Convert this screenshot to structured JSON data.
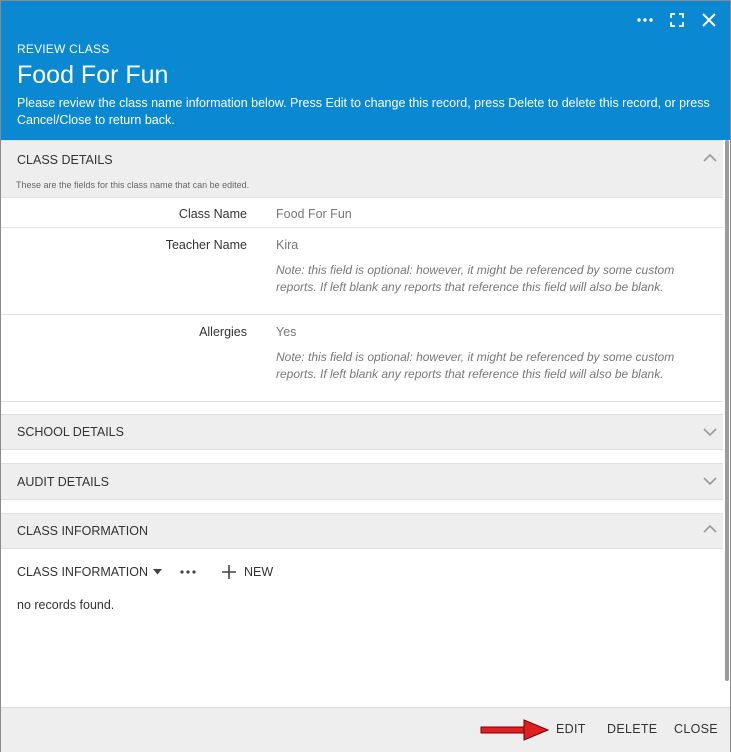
{
  "header": {
    "kicker": "REVIEW CLASS",
    "title": "Food For Fun",
    "description": "Please review the class name information below. Press Edit to change this record, press Delete to delete this record, or press Cancel/Close to return back."
  },
  "sections": {
    "class_details": {
      "label": "CLASS DETAILS",
      "subtitle": "These are the fields for this class name that can be edited.",
      "expanded": true
    },
    "school_details": {
      "label": "SCHOOL DETAILS",
      "expanded": false
    },
    "audit_details": {
      "label": "AUDIT DETAILS",
      "expanded": false
    },
    "class_information": {
      "label": "CLASS INFORMATION",
      "expanded": true
    }
  },
  "fields": [
    {
      "label": "Class Name",
      "value": "Food For Fun",
      "note": ""
    },
    {
      "label": "Teacher Name",
      "value": "Kira",
      "note": "Note: this field is optional: however, it might be referenced by some custom reports. If left blank any reports that reference this field will also be blank."
    },
    {
      "label": "Allergies",
      "value": "Yes",
      "note": "Note: this field is optional: however, it might be referenced by some custom reports. If left blank any reports that reference this field will also be blank."
    }
  ],
  "subgrid": {
    "title": "CLASS INFORMATION",
    "new_label": "NEW",
    "empty_text": "no records found."
  },
  "footer": {
    "edit_label": "EDIT",
    "delete_label": "DELETE",
    "close_label": "CLOSE"
  },
  "colors": {
    "header_bg": "#0a88d1",
    "annotation_arrow": "#e02020"
  },
  "icons": [
    "more-icon",
    "maximize-icon",
    "close-icon",
    "chevron-up-icon",
    "chevron-down-icon",
    "caret-down-icon",
    "plus-icon",
    "arrow-annotation"
  ]
}
